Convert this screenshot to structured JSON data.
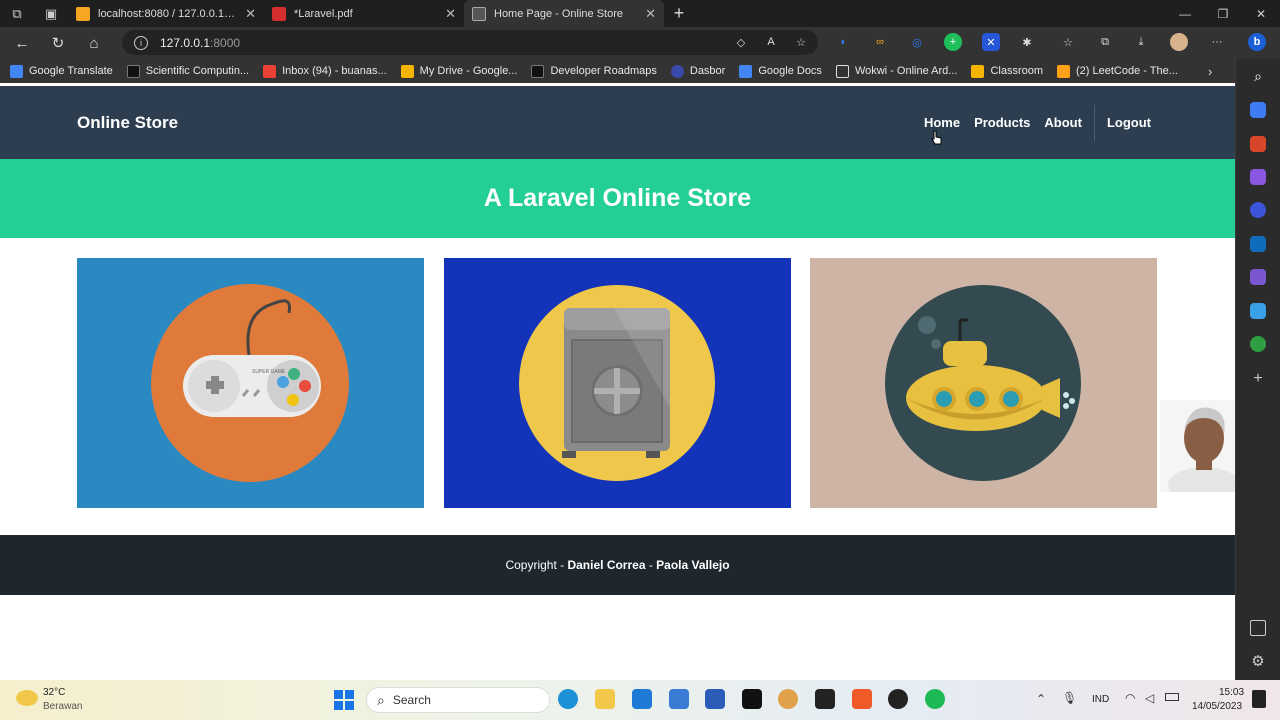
{
  "browser": {
    "tabs": [
      {
        "title": "localhost:8080 / 127.0.0.1 / onlin",
        "color": "#f5a623"
      },
      {
        "title": "*Laravel.pdf",
        "color": "#d32f2f"
      },
      {
        "title": "Home Page - Online Store",
        "color": "#e0e0e0"
      }
    ],
    "address": {
      "host": "127.0.0.1",
      "port": ":8000"
    },
    "bookmarks": [
      {
        "label": "Google Translate",
        "color": "#4285f4"
      },
      {
        "label": "Scientific Computin...",
        "color": "#111111"
      },
      {
        "label": "Inbox (94) - buanas...",
        "color": "#ea4335"
      },
      {
        "label": "My Drive - Google...",
        "color": "#f4b400"
      },
      {
        "label": "Developer Roadmaps",
        "color": "#111111"
      },
      {
        "label": "Dasbor",
        "color": "#3949ab"
      },
      {
        "label": "Google Docs",
        "color": "#4285f4"
      },
      {
        "label": "Wokwi - Online Ard...",
        "color": "#dddddd"
      },
      {
        "label": "Classroom",
        "color": "#f4b400"
      },
      {
        "label": "(2) LeetCode - The...",
        "color": "#ffa116"
      }
    ]
  },
  "site": {
    "brand": "Online Store",
    "nav": {
      "home": "Home",
      "products": "Products",
      "about": "About",
      "logout": "Logout"
    },
    "hero_title": "A Laravel Online Store",
    "cards": [
      {
        "bg": "#2a89c0",
        "circle": "#e07a3a",
        "icon": "gamepad-icon",
        "console_text": "SUPER GAME"
      },
      {
        "bg": "#1334b8",
        "circle": "#efc74a",
        "icon": "safe-icon"
      },
      {
        "bg": "#cdb4a5",
        "circle": "#334a50",
        "icon": "submarine-icon"
      }
    ],
    "footer": {
      "prefix": "Copyright - ",
      "author1": "Daniel Correa",
      "sep": " - ",
      "author2": "Paola Vallejo"
    }
  },
  "taskbar": {
    "weather_temp": "32°C",
    "weather_desc": "Berawan",
    "search_placeholder": "Search",
    "lang": "IND",
    "time": "15:03",
    "date": "14/05/2023"
  }
}
